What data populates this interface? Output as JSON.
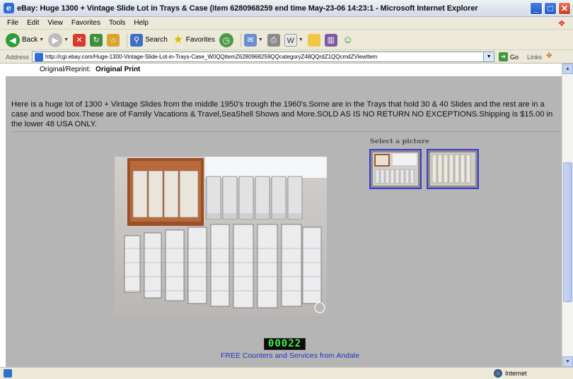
{
  "window": {
    "title": "eBay: Huge 1300 + Vintage Slide Lot in Trays & Case (item 6280968259 end time May-23-06 14:23:1 - Microsoft Internet Explorer",
    "buttons": [
      "minimize",
      "maximize",
      "close"
    ]
  },
  "menu": {
    "items": [
      "File",
      "Edit",
      "View",
      "Favorites",
      "Tools",
      "Help"
    ]
  },
  "toolbar": {
    "back_label": "Back",
    "search_label": "Search",
    "favorites_label": "Favorites"
  },
  "address": {
    "label": "Address",
    "url": "http://cgi.ebay.com/Huge-1300-Vintage-Slide-Lot-in-Trays-Case_W0QQitemZ6280968259QQcategoryZ48QQrdZ1QQcmdZViewItem",
    "go_label": "Go",
    "links_label": "Links"
  },
  "listing": {
    "orig_label": "Original/Reprint:",
    "orig_value": "Original Print",
    "description": "Here is a huge lot of 1300 + Vintage Slides from the middle 1950's trough the 1960's.Some are in the Trays that hold 30 & 40 Slides and the rest are in a case and wood box.These are of Family Vacations & Travel,SeaShell Shows and More.SOLD AS IS NO RETURN NO EXCEPTIONS.Shipping is $15.00 in the lower 48 USA ONLY.",
    "select_picture_label": "Select a picture",
    "counter_value": "00022",
    "counter_link": "FREE Counters and Services from Andale"
  },
  "status": {
    "zone_label": "Internet"
  },
  "colors": {
    "content_bg": "#b5b5b5",
    "counter_digits": "#42f04a",
    "link": "#2233bb",
    "thumb_border": "#3c3cd8"
  }
}
